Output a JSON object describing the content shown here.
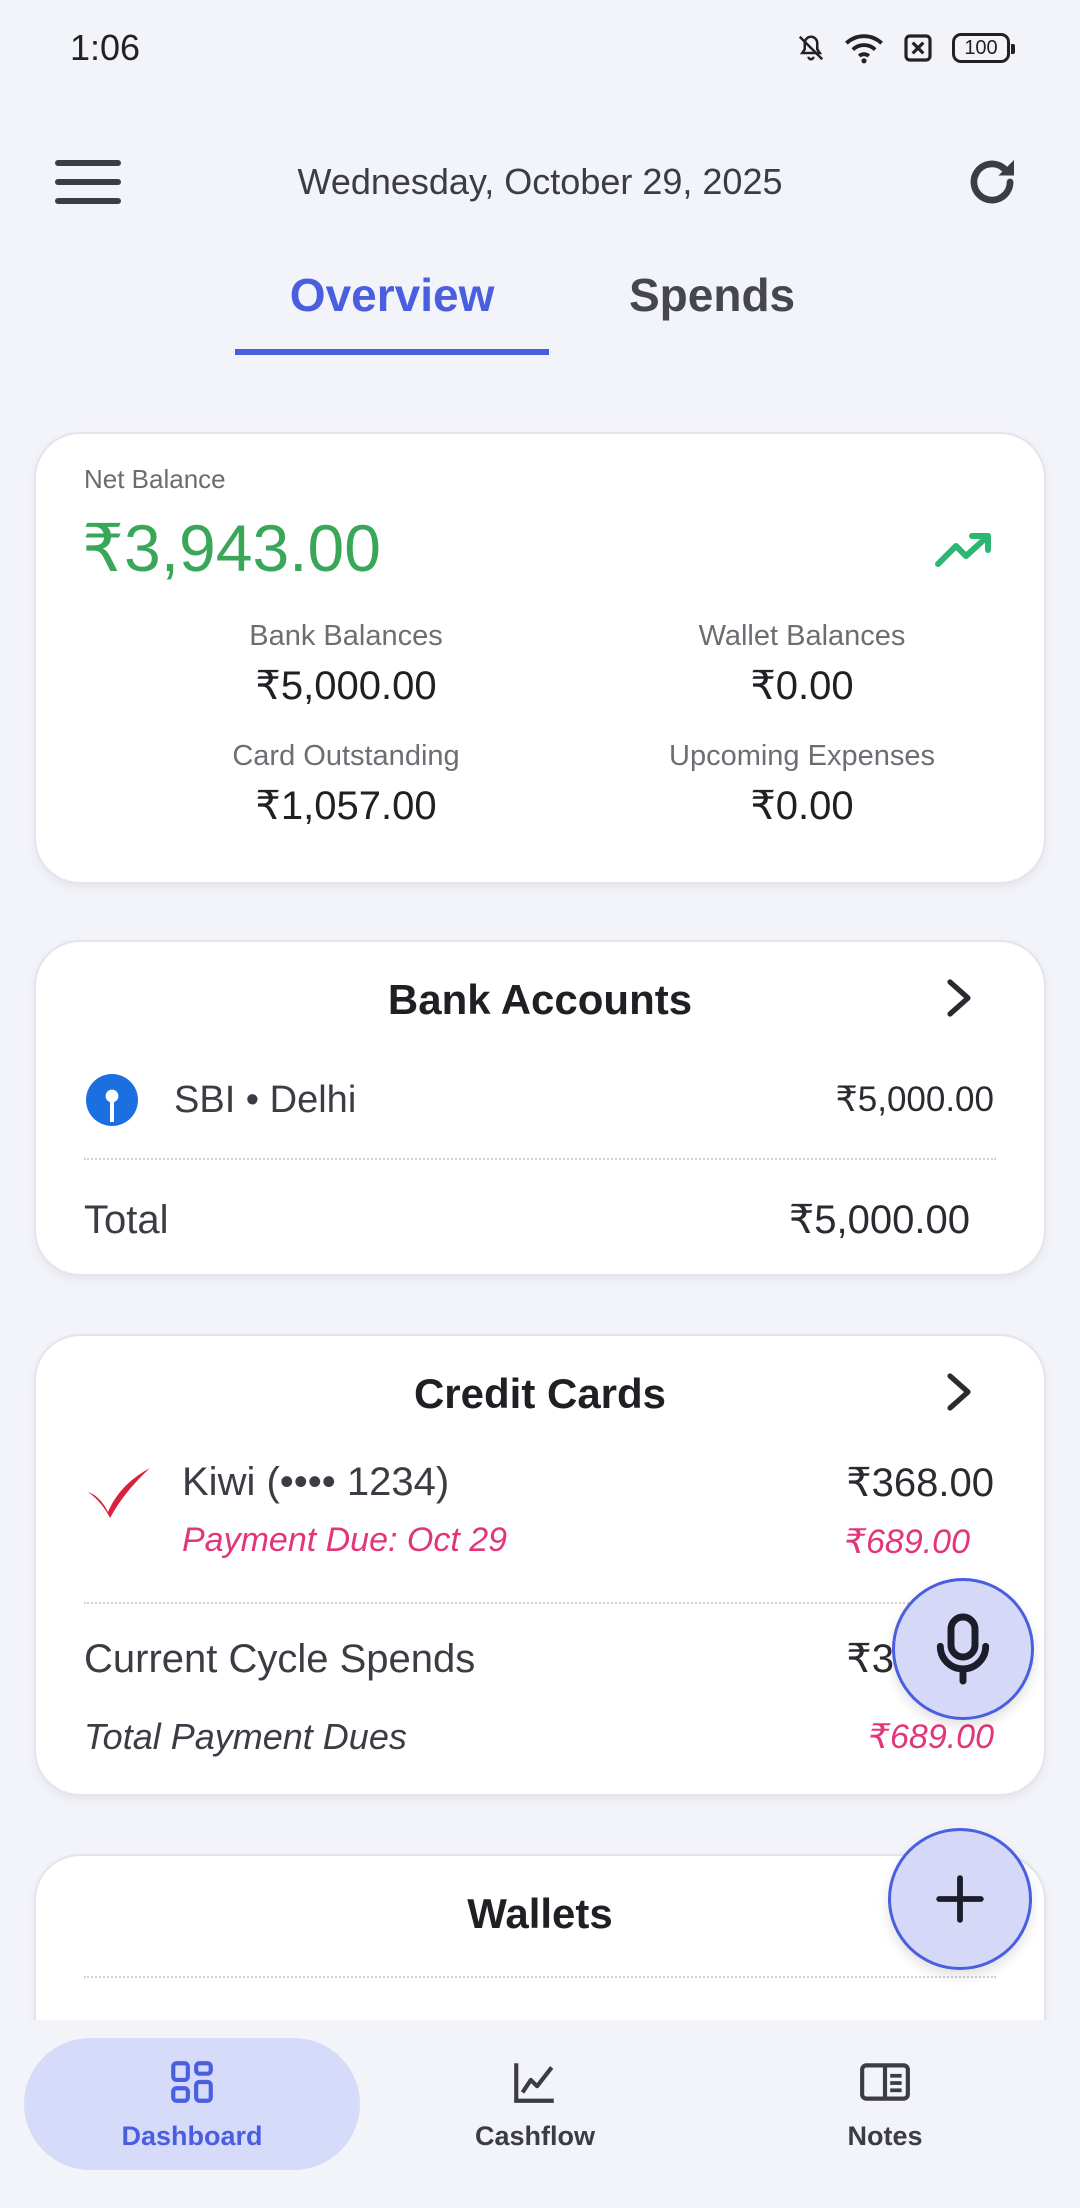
{
  "status_bar": {
    "time": "1:06",
    "battery": "100"
  },
  "header": {
    "date": "Wednesday, October 29, 2025"
  },
  "tabs": [
    {
      "label": "Overview"
    },
    {
      "label": "Spends"
    }
  ],
  "net_balance": {
    "label": "Net Balance",
    "value": "₹3,943.00",
    "trend_color": "#2bb673",
    "items": [
      {
        "label": "Bank Balances",
        "value": "₹5,000.00"
      },
      {
        "label": "Wallet Balances",
        "value": "₹0.00"
      },
      {
        "label": "Card Outstanding",
        "value": "₹1,057.00"
      },
      {
        "label": "Upcoming Expenses",
        "value": "₹0.00"
      }
    ]
  },
  "bank_accounts": {
    "title": "Bank Accounts",
    "accounts": [
      {
        "name": "SBI • Delhi",
        "amount": "₹5,000.00",
        "icon": "sbi-icon"
      }
    ],
    "total_label": "Total",
    "total_amount": "₹5,000.00"
  },
  "credit_cards": {
    "title": "Credit Cards",
    "cards": [
      {
        "name": "Kiwi (•••• 1234)",
        "amount": "₹368.00",
        "due_label": "Payment Due: Oct 29",
        "due_amount": "₹689.00",
        "icon": "kiwi-icon"
      }
    ],
    "cycle_label": "Current Cycle Spends",
    "cycle_amount": "₹3",
    "dues_label": "Total Payment Dues",
    "dues_amount": "₹689.00"
  },
  "wallets": {
    "title": "Wallets"
  },
  "bottom_nav": [
    {
      "label": "Dashboard",
      "icon": "dashboard-icon"
    },
    {
      "label": "Cashflow",
      "icon": "chart-icon"
    },
    {
      "label": "Notes",
      "icon": "notes-icon"
    }
  ],
  "colors": {
    "accent": "#4a5ee0",
    "positive": "#3aa657",
    "due": "#e2357a"
  }
}
